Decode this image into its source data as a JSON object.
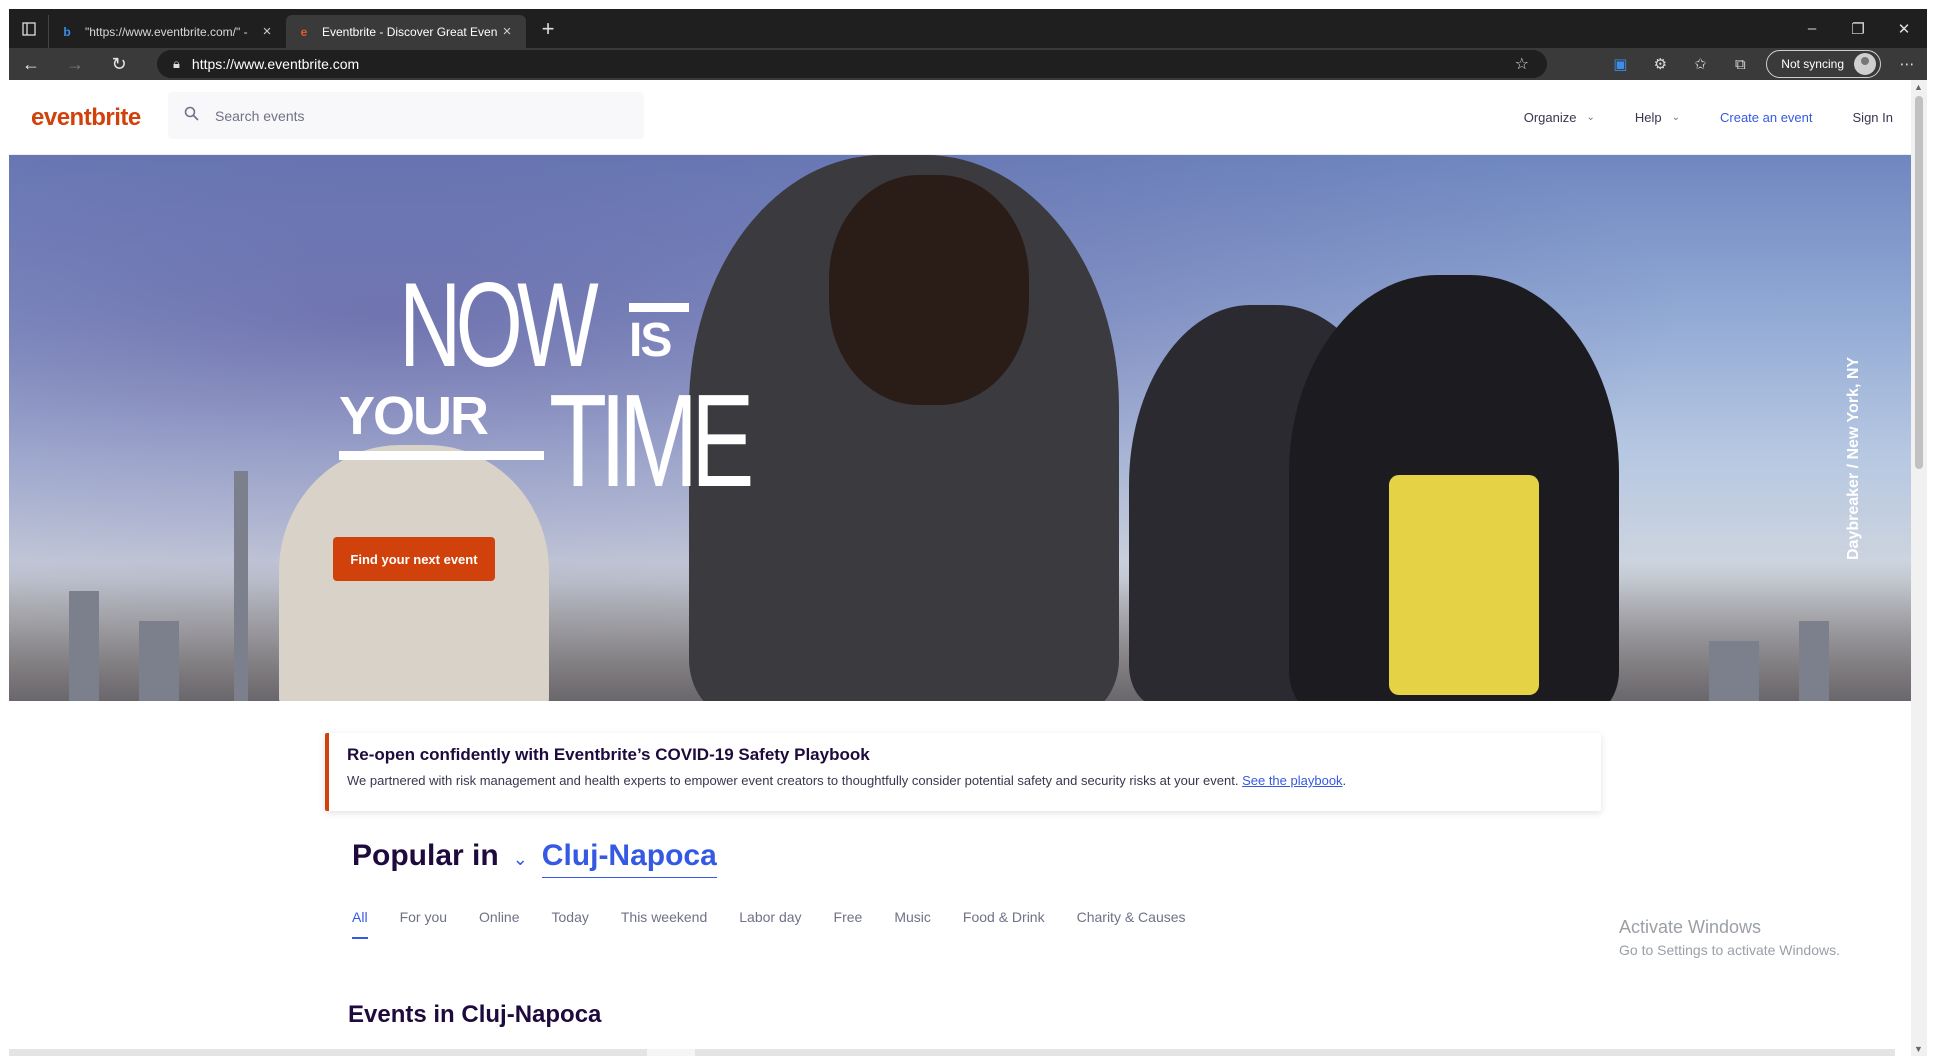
{
  "browser": {
    "tabs": [
      {
        "title": "\"https://www.eventbrite.com/\" -",
        "active": false,
        "favicon": "bing-icon"
      },
      {
        "title": "Eventbrite - Discover Great Even",
        "active": true,
        "favicon": "eventbrite-icon"
      }
    ],
    "url": "https://www.eventbrite.com",
    "sync_label": "Not syncing"
  },
  "header": {
    "logo": "eventbrite",
    "search_placeholder": "Search events",
    "nav": {
      "organize": "Organize",
      "help": "Help",
      "create": "Create an event",
      "signin": "Sign In"
    }
  },
  "hero": {
    "headline_now": "NOW",
    "headline_is": "IS",
    "headline_your": "YOUR",
    "headline_time": "TIME",
    "cta": "Find your next event",
    "credit": "Daybreaker / New York, NY"
  },
  "safety": {
    "title": "Re-open confidently with Eventbrite’s COVID-19 Safety Playbook",
    "body": "We partnered with risk management and health experts to empower event creators to thoughtfully consider potential safety and security risks at your event.",
    "link": "See the playbook",
    "period": "."
  },
  "popular": {
    "label": "Popular in",
    "city": "Cluj-Napoca",
    "tabs": [
      "All",
      "For you",
      "Online",
      "Today",
      "This weekend",
      "Labor day",
      "Free",
      "Music",
      "Food & Drink",
      "Charity & Causes"
    ]
  },
  "events_title": "Events in Cluj-Napoca",
  "watermark": {
    "line1": "Activate Windows",
    "line2": "Go to Settings to activate Windows."
  },
  "colors": {
    "brand": "#d1410c",
    "link": "#3659e3",
    "heading": "#1e0a3c"
  }
}
